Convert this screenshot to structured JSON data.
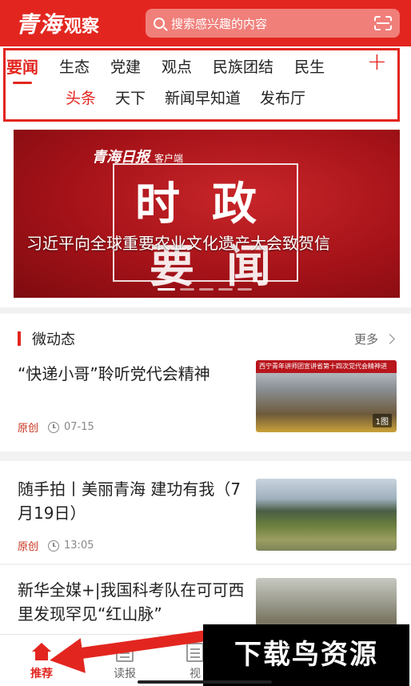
{
  "header": {
    "logo_main": "青海",
    "logo_sub": "观察",
    "search_placeholder": "搜索感兴趣的内容",
    "icons": [
      "search-icon",
      "scan-icon"
    ]
  },
  "channels": {
    "row1": [
      "要闻",
      "生态",
      "党建",
      "观点",
      "民族团结",
      "民生"
    ],
    "row2": [
      "头条",
      "天下",
      "新闻早知道",
      "发布厅"
    ],
    "plus": "+",
    "active_row1": "要闻",
    "active_row2": "头条"
  },
  "banner": {
    "brand": "青海日报",
    "brand_sub": "客户端",
    "big_line1": "时政",
    "big_line2": "要闻",
    "caption": "习近平向全球重要农业文化遗产大会致贺信",
    "dots": 5,
    "active_dot": 0
  },
  "section": {
    "title": "微动态",
    "more": "更多"
  },
  "news": [
    {
      "title": "“快递小哥”聆听党代会精神",
      "tag": "原创",
      "time": "07-15",
      "thumb_banner": "西宁青年讲师团宣讲省第十四次党代会精神进",
      "thumb_badge": "1图"
    },
    {
      "title": "随手拍丨美丽青海 建功有我（7月19日）",
      "tag": "原创",
      "time": "13:05"
    },
    {
      "title": "新华全媒+|我国科考队在可可西里发现罕见“红山脉”"
    }
  ],
  "bottom_nav": [
    {
      "label": "推荐",
      "icon": "home-icon"
    },
    {
      "label": "读报",
      "icon": "newspaper-icon"
    },
    {
      "label": "视",
      "icon": "video-icon"
    }
  ],
  "watermark": "下载鸟资源",
  "colors": {
    "brand_red": "#e2261f",
    "tag_red": "#c8331f"
  }
}
